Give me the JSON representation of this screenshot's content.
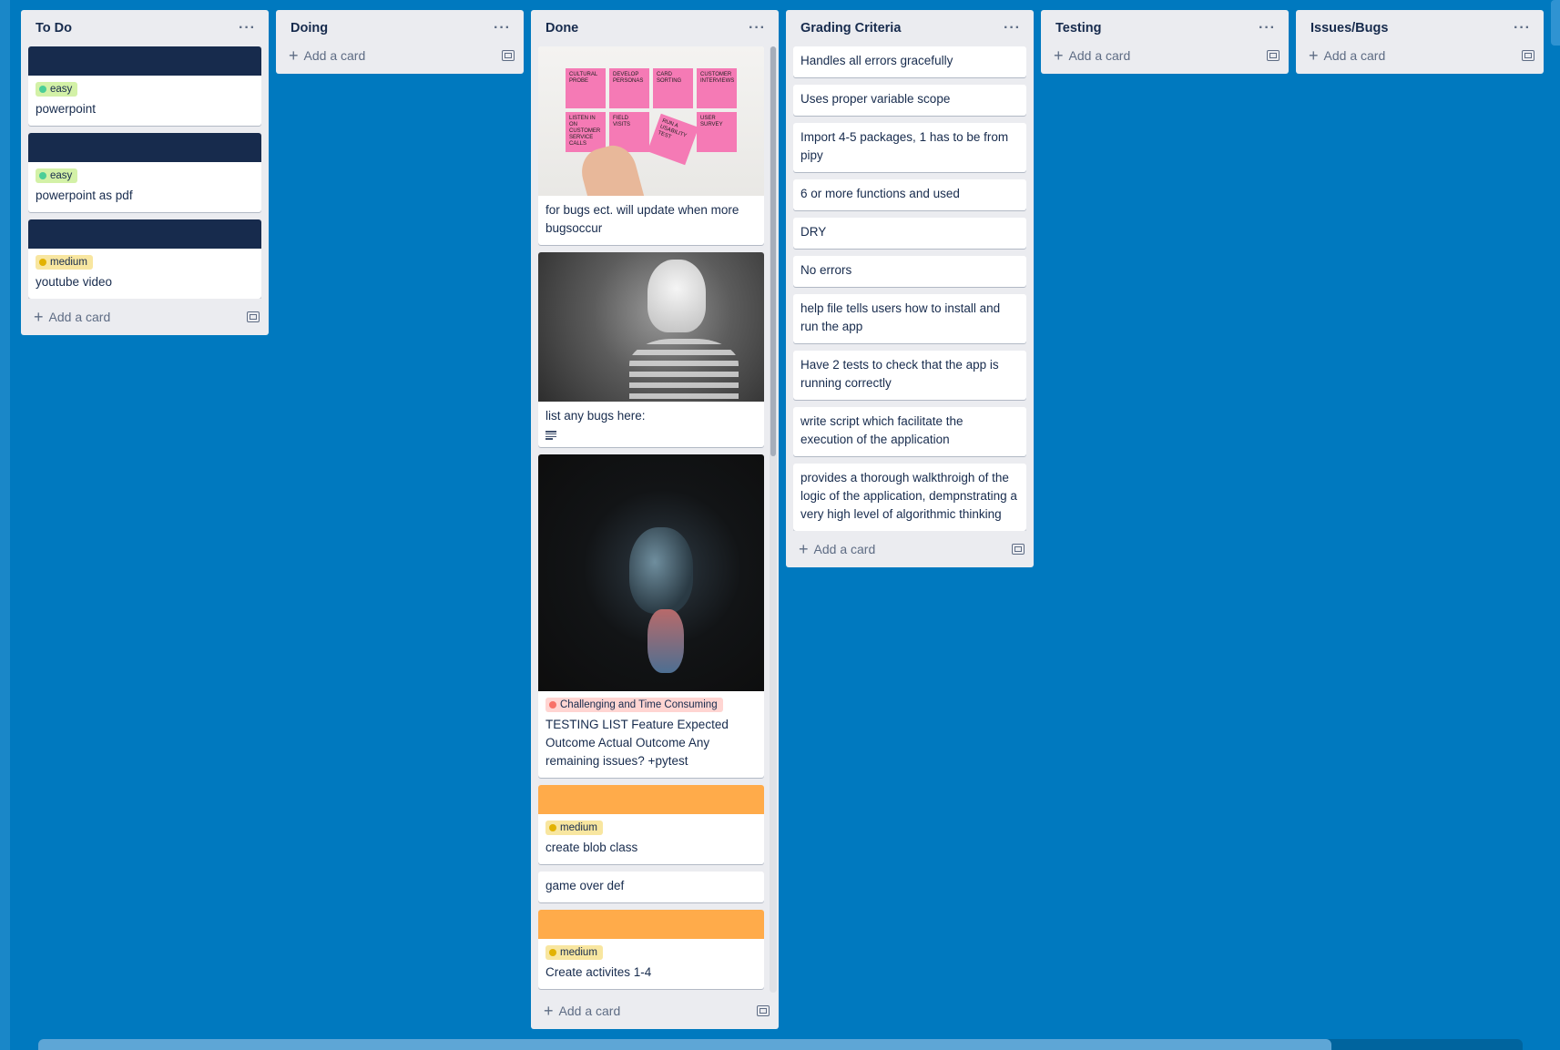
{
  "lists": {
    "todo": {
      "title": "To Do",
      "add_card": "Add a card",
      "cards": [
        {
          "label": "easy",
          "text": "powerpoint"
        },
        {
          "label": "easy",
          "text": "powerpoint as pdf"
        },
        {
          "label": "medium",
          "text": "youtube video"
        }
      ]
    },
    "doing": {
      "title": "Doing",
      "add_card": "Add a card"
    },
    "done": {
      "title": "Done",
      "add_card": "Add a card",
      "cards": [
        {
          "text": "for bugs ect. will update when more bugsoccur",
          "sticky_notes": [
            "CULTURAL PROBE",
            "DEVELOP PERSONAS",
            "CARD SORTING",
            "CUSTOMER INTERVIEWS",
            "LISTEN IN ON CUSTOMER SERVICE CALLS",
            "FIELD VISITS",
            "RUN A USABILITY TEST",
            "USER SURVEY"
          ]
        },
        {
          "text": "list any bugs here:"
        },
        {
          "label": "Challenging and Time Consuming",
          "text": "TESTING LIST Feature Expected Outcome Actual Outcome Any remaining issues? +pytest"
        },
        {
          "label": "medium",
          "text": "create blob class"
        },
        {
          "text": "game over def"
        },
        {
          "label": "medium",
          "text": "Create activites 1-4"
        }
      ]
    },
    "grading": {
      "title": "Grading Criteria",
      "add_card": "Add a card",
      "cards": [
        "Handles all errors gracefully",
        "Uses proper variable scope",
        "Import 4-5 packages, 1 has to be from pipy",
        "6 or more functions and used",
        "DRY",
        "No errors",
        "help file tells users how to install and run the app",
        "Have 2 tests to check that the app is running correctly",
        "write script which facilitate the execution of the application",
        "provides a thorough walkthroigh of the logic of the application, dempnstrating a very high level of algorithmic thinking"
      ]
    },
    "testing": {
      "title": "Testing",
      "add_card": "Add a card"
    },
    "issues": {
      "title": "Issues/Bugs",
      "add_card": "Add a card"
    }
  },
  "colors": {
    "board_bg": "#0079bf",
    "list_bg": "#ebecf0",
    "cover_navy": "#172b4d",
    "cover_orange": "#ffab4a"
  },
  "icons": {
    "list_menu": "ellipsis-icon",
    "add": "plus-icon",
    "template": "card-template-icon",
    "description": "description-icon"
  }
}
